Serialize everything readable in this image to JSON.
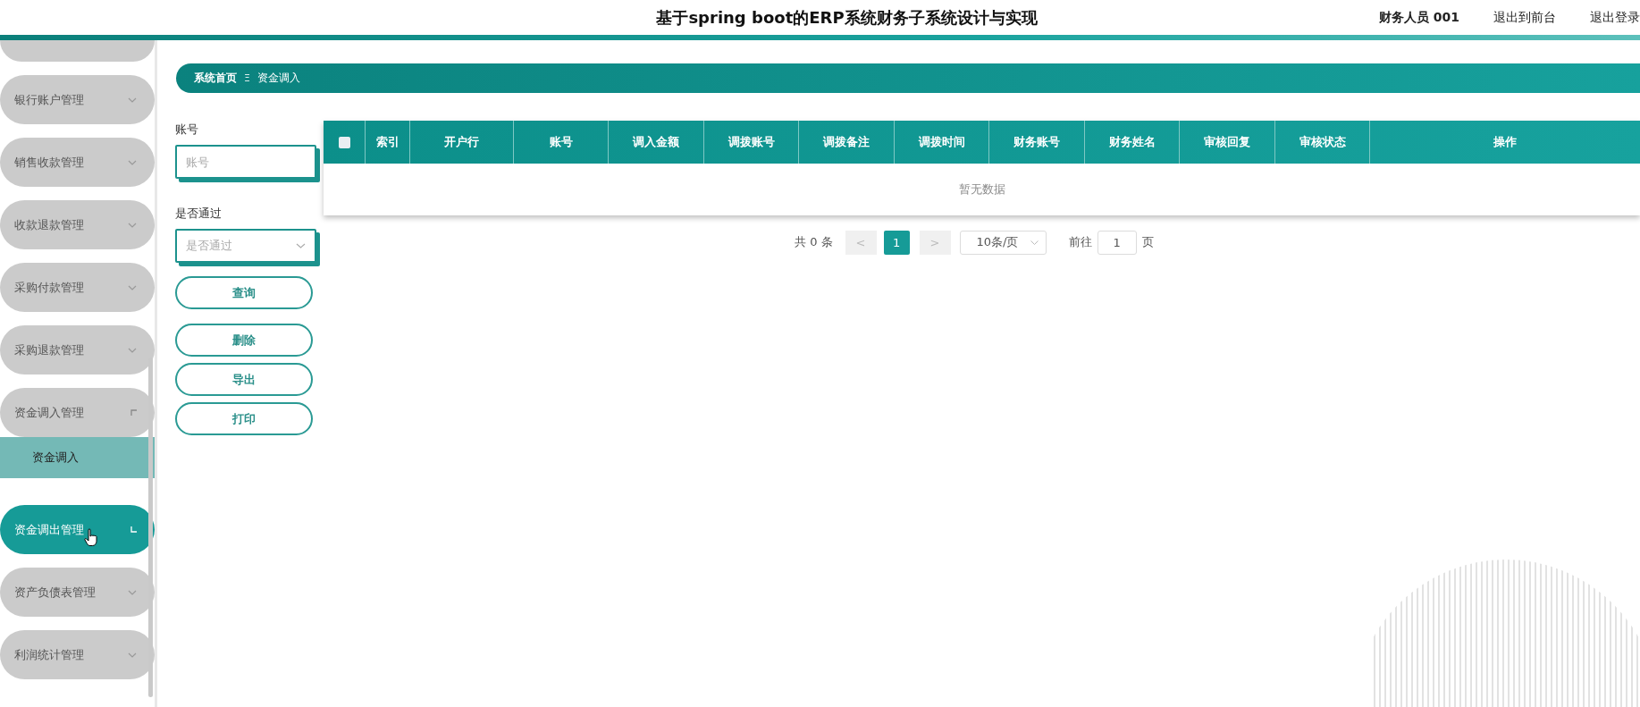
{
  "header": {
    "title": "基于spring boot的ERP系统财务子系统设计与实现",
    "user": "财务人员 001",
    "links": [
      "退出到前台",
      "退出登录"
    ]
  },
  "sidebar": {
    "items": [
      {
        "label": "银行账户管理",
        "kind": "group",
        "expanded": false,
        "hovered": false
      },
      {
        "label": "销售收款管理",
        "kind": "group",
        "expanded": false,
        "hovered": false
      },
      {
        "label": "收款退款管理",
        "kind": "group",
        "expanded": false,
        "hovered": false
      },
      {
        "label": "采购付款管理",
        "kind": "group",
        "expanded": false,
        "hovered": false
      },
      {
        "label": "采购退款管理",
        "kind": "group",
        "expanded": false,
        "hovered": false
      },
      {
        "label": "资金调入管理",
        "kind": "group",
        "expanded": true,
        "hovered": false
      },
      {
        "label": "资金调入",
        "kind": "sub",
        "selected": true
      },
      {
        "label": "资金调出管理",
        "kind": "group",
        "expanded": false,
        "hovered": true
      },
      {
        "label": "资产负债表管理",
        "kind": "group",
        "expanded": false,
        "hovered": false
      },
      {
        "label": "利润统计管理",
        "kind": "group",
        "expanded": false,
        "hovered": false
      }
    ]
  },
  "breadcrumb": {
    "home": "系统首页",
    "separator": "Ξ",
    "current": "资金调入"
  },
  "filters": [
    {
      "label": "账号",
      "kind": "input",
      "placeholder": "账号"
    },
    {
      "label": "是否通过",
      "kind": "select",
      "placeholder": "是否通过"
    }
  ],
  "buttons": [
    "查询",
    "删除",
    "导出",
    "打印"
  ],
  "table": {
    "select_all": {
      "checked": false
    },
    "columns": [
      "索引",
      "开户行",
      "账号",
      "调入金额",
      "调拨账号",
      "调拨备注",
      "调拨时间",
      "财务账号",
      "财务姓名",
      "审核回复",
      "审核状态",
      "操作"
    ],
    "empty_text": "暂无数据"
  },
  "pagination": {
    "total": "共 0 条",
    "prev": "<",
    "pages": [
      {
        "label": "1",
        "selected": true
      }
    ],
    "next": ">",
    "page_size": "10条/页",
    "goto_label": "前往",
    "goto_value": "1",
    "goto_suffix": "页"
  }
}
